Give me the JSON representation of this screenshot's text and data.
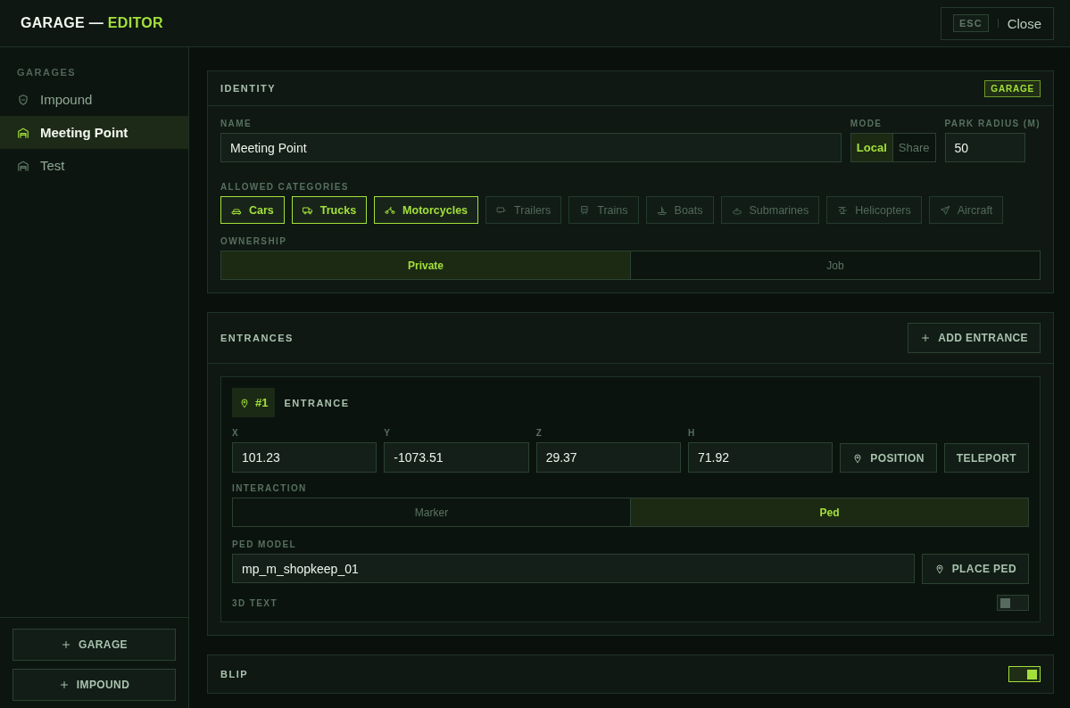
{
  "window": {
    "title": "GARAGE —",
    "title_accent": "EDITOR",
    "close_key": "ESC",
    "close_label": "Close"
  },
  "sidebar": {
    "heading": "GARAGES",
    "items": [
      {
        "label": "Impound",
        "kind": "impound",
        "selected": false
      },
      {
        "label": "Meeting Point",
        "kind": "garage",
        "selected": true
      },
      {
        "label": "Test",
        "kind": "garage",
        "selected": false
      }
    ],
    "buttons": [
      "GARAGE",
      "IMPOUND"
    ]
  },
  "identity": {
    "title": "IDENTITY",
    "badge": "GARAGE",
    "name_label": "NAME",
    "name_value": "Meeting Point",
    "mode_label": "MODE",
    "modes": [
      {
        "label": "Local",
        "selected": true
      },
      {
        "label": "Share",
        "selected": false
      }
    ],
    "radius_label": "PARK RADIUS (M)",
    "radius_value": "50",
    "categories_label": "ALLOWED CATEGORIES",
    "categories": [
      {
        "label": "Cars",
        "kind": "car",
        "selected": true
      },
      {
        "label": "Trucks",
        "kind": "truck",
        "selected": true
      },
      {
        "label": "Motorcycles",
        "kind": "motorcycle",
        "selected": true
      },
      {
        "label": "Trailers",
        "kind": "trailer",
        "selected": false
      },
      {
        "label": "Trains",
        "kind": "train",
        "selected": false
      },
      {
        "label": "Boats",
        "kind": "boat",
        "selected": false
      },
      {
        "label": "Submarines",
        "kind": "submarine",
        "selected": false
      },
      {
        "label": "Helicopters",
        "kind": "helicopter",
        "selected": false
      },
      {
        "label": "Aircraft",
        "kind": "plane",
        "selected": false
      }
    ],
    "ownership_label": "OWNERSHIP",
    "ownership": [
      {
        "label": "Private",
        "selected": true
      },
      {
        "label": "Job",
        "selected": false
      }
    ]
  },
  "entrances": {
    "title": "ENTRANCES",
    "add_button": "ADD ENTRANCE",
    "items": [
      {
        "number": "#1",
        "title": "ENTRANCE",
        "coords": [
          {
            "label": "X",
            "value": "101.23"
          },
          {
            "label": "Y",
            "value": "-1073.51"
          },
          {
            "label": "Z",
            "value": "29.37"
          },
          {
            "label": "H",
            "value": "71.92"
          }
        ],
        "position_button": "POSITION",
        "teleport_button": "TELEPORT",
        "interaction_label": "INTERACTION",
        "interaction": [
          {
            "label": "Marker",
            "selected": false
          },
          {
            "label": "Ped",
            "selected": true
          }
        ],
        "ped_model_label": "PED MODEL",
        "ped_model": "mp_m_shopkeep_01",
        "place_ped_button": "PLACE PED",
        "text3d_label": "3D TEXT",
        "text3d_on": false
      }
    ]
  },
  "blip": {
    "title": "BLIP",
    "on": true
  }
}
